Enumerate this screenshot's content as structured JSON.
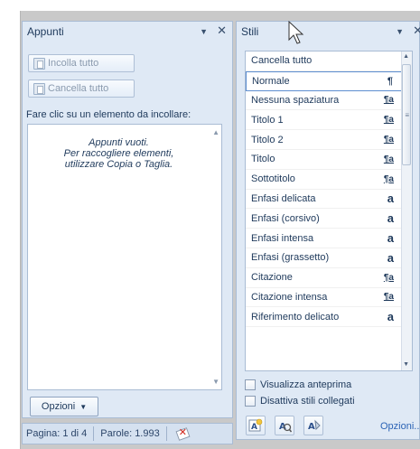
{
  "clipboard": {
    "title": "Appunti",
    "paste_all": "Incolla tutto",
    "clear_all": "Cancella tutto",
    "instruction": "Fare clic su un elemento da incollare:",
    "empty_line1": "Appunti vuoti.",
    "empty_line2": "Per raccogliere elementi,",
    "empty_line3": "utilizzare Copia o Taglia.",
    "options": "Opzioni"
  },
  "status": {
    "page": "Pagina: 1 di 4",
    "words": "Parole: 1.993"
  },
  "styles": {
    "title": "Stili",
    "items": [
      {
        "label": "Cancella tutto",
        "kind": "none",
        "mark": ""
      },
      {
        "label": "Normale",
        "kind": "paragraph",
        "mark": "¶"
      },
      {
        "label": "Nessuna spaziatura",
        "kind": "linked",
        "mark": "¶a"
      },
      {
        "label": "Titolo 1",
        "kind": "linked",
        "mark": "¶a"
      },
      {
        "label": "Titolo 2",
        "kind": "linked",
        "mark": "¶a"
      },
      {
        "label": "Titolo",
        "kind": "linked",
        "mark": "¶a"
      },
      {
        "label": "Sottotitolo",
        "kind": "linked",
        "mark": "¶a"
      },
      {
        "label": "Enfasi delicata",
        "kind": "character",
        "mark": "a"
      },
      {
        "label": "Enfasi (corsivo)",
        "kind": "character",
        "mark": "a"
      },
      {
        "label": "Enfasi intensa",
        "kind": "character",
        "mark": "a"
      },
      {
        "label": "Enfasi (grassetto)",
        "kind": "character",
        "mark": "a"
      },
      {
        "label": "Citazione",
        "kind": "linked",
        "mark": "¶a"
      },
      {
        "label": "Citazione intensa",
        "kind": "linked",
        "mark": "¶a"
      },
      {
        "label": "Riferimento delicato",
        "kind": "character",
        "mark": "a"
      }
    ],
    "selected_index": 1,
    "show_preview": "Visualizza anteprima",
    "disable_linked": "Disattiva stili collegati",
    "options_link": "Opzioni..."
  },
  "colors": {
    "pane_bg": "#dfe9f5",
    "border": "#a9bcd4",
    "text": "#1e395b",
    "link": "#2b63b5",
    "selection_border": "#5d8ed0"
  }
}
